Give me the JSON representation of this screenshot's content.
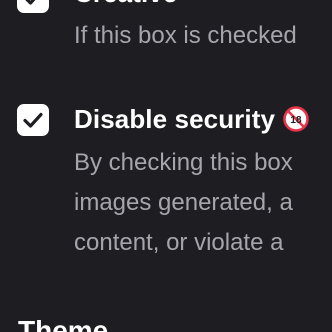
{
  "options": [
    {
      "title": "Creative",
      "checked": true,
      "description_lines": [
        "If this box is checked"
      ]
    },
    {
      "title": "Disable security",
      "checked": true,
      "badge": "🔞",
      "badge_icon": "no-one-under-18-icon",
      "description_lines": [
        "By checking this box",
        "images generated, a",
        "content, or violate a"
      ]
    }
  ],
  "section": {
    "heading": "Theme"
  },
  "colors": {
    "background": "#1e1d21",
    "title_text": "#ffffff",
    "description_text": "#a6a5ac",
    "checkbox_fill": "#ffffff",
    "checkmark": "#1e1d21",
    "badge_red": "#e8344a"
  }
}
